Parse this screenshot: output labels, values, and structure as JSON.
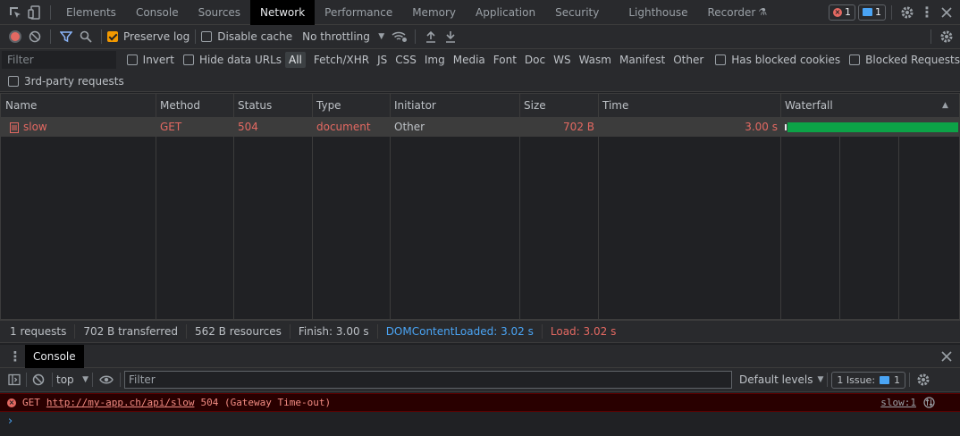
{
  "tabs": [
    {
      "label": "Elements",
      "active": false
    },
    {
      "label": "Console",
      "active": false
    },
    {
      "label": "Sources",
      "active": false
    },
    {
      "label": "Network",
      "active": true
    },
    {
      "label": "Performance",
      "active": false
    },
    {
      "label": "Memory",
      "active": false
    },
    {
      "label": "Application",
      "active": false
    },
    {
      "label": "Security",
      "active": false
    },
    {
      "label": "Lighthouse",
      "active": false
    },
    {
      "label": "Recorder",
      "active": false
    }
  ],
  "badges": {
    "errors": "1",
    "messages": "1"
  },
  "toolbar": {
    "preserve_log": "Preserve log",
    "preserve_log_checked": true,
    "disable_cache": "Disable cache",
    "throttling": "No throttling"
  },
  "filterbar": {
    "filter_placeholder": "Filter",
    "invert": "Invert",
    "hide_data_urls": "Hide data URLs",
    "types": [
      "All",
      "Fetch/XHR",
      "JS",
      "CSS",
      "Img",
      "Media",
      "Font",
      "Doc",
      "WS",
      "Wasm",
      "Manifest",
      "Other"
    ],
    "active_type": "All",
    "blocked_cookies": "Has blocked cookies",
    "blocked_requests": "Blocked Requests",
    "third_party": "3rd-party requests"
  },
  "table": {
    "columns": [
      "Name",
      "Method",
      "Status",
      "Type",
      "Initiator",
      "Size",
      "Time",
      "Waterfall"
    ],
    "rows": [
      {
        "name": "slow",
        "method": "GET",
        "status": "504",
        "type": "document",
        "initiator": "Other",
        "size": "702 B",
        "time": "3.00 s"
      }
    ]
  },
  "status": {
    "requests": "1 requests",
    "transferred": "702 B transferred",
    "resources": "562 B resources",
    "finish": "Finish: 3.00 s",
    "dom_content_loaded": "DOMContentLoaded: 3.02 s",
    "load": "Load: 3.02 s"
  },
  "colors": {
    "dcl": "#4aa4f4",
    "load": "#e46962",
    "error": "#e46962",
    "waterfall_bar": "#0ca347"
  },
  "drawer": {
    "tab": "Console",
    "context": "top",
    "filter_placeholder": "Filter",
    "levels": "Default levels",
    "issues_label": "1 Issue:",
    "issues_count": "1"
  },
  "console": {
    "error": {
      "method": "GET",
      "url": "http://my-app.ch/api/slow",
      "message": "504 (Gateway Time-out)",
      "source": "slow:1"
    },
    "prompt": "›"
  }
}
